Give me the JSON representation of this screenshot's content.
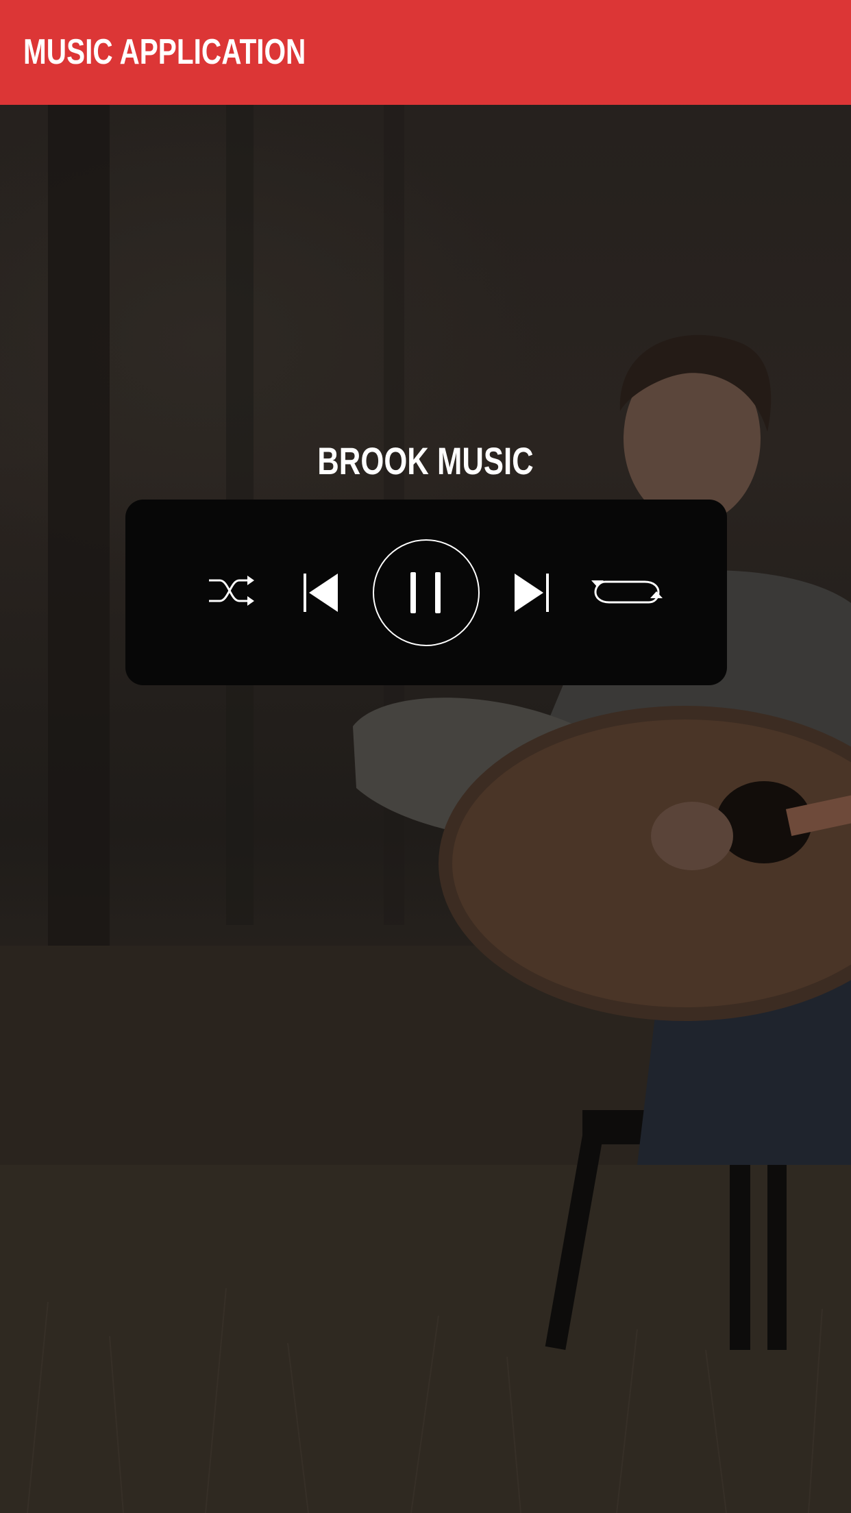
{
  "header": {
    "title": "MUSIC APPLICATION",
    "color": "#dc3636"
  },
  "player": {
    "track_title": "BROOK MUSIC",
    "state": "playing",
    "controls": {
      "shuffle": "shuffle-icon",
      "previous": "skip-previous-icon",
      "play_pause": "pause-icon",
      "next": "skip-next-icon",
      "repeat": "repeat-icon"
    }
  }
}
